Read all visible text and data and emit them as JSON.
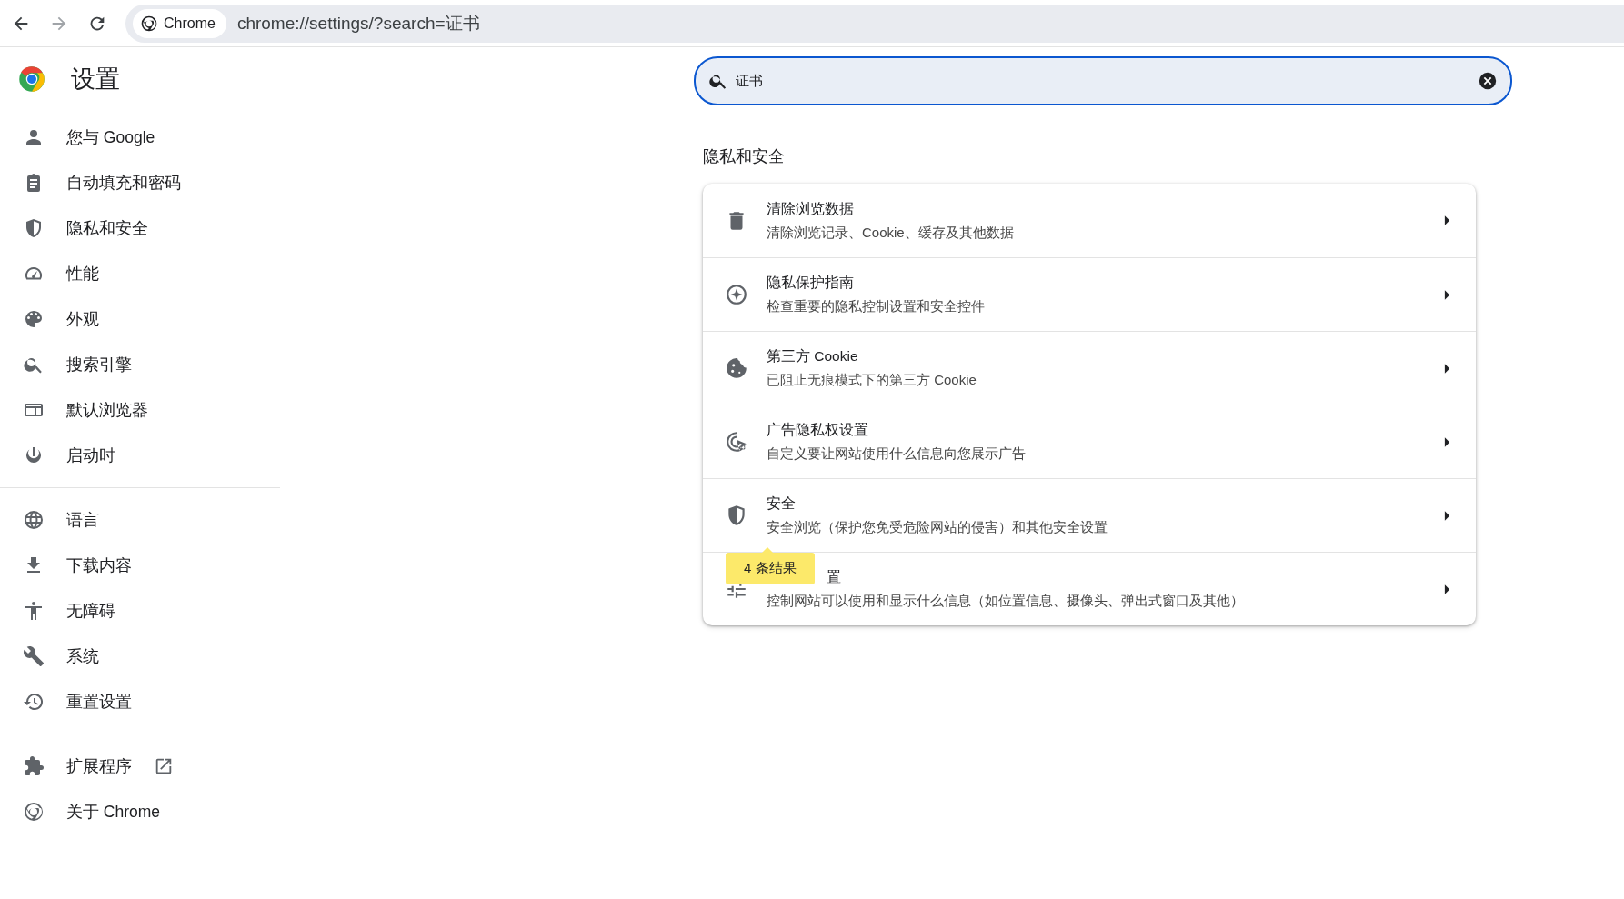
{
  "toolbar": {
    "chip": "Chrome",
    "url": "chrome://settings/?search=证书",
    "forward_disabled": true
  },
  "sidebar": {
    "title": "设置",
    "groups": [
      [
        {
          "label": "您与 Google"
        },
        {
          "label": "自动填充和密码"
        },
        {
          "label": "隐私和安全"
        },
        {
          "label": "性能"
        },
        {
          "label": "外观"
        },
        {
          "label": "搜索引擎"
        },
        {
          "label": "默认浏览器"
        },
        {
          "label": "启动时"
        }
      ],
      [
        {
          "label": "语言"
        },
        {
          "label": "下载内容"
        },
        {
          "label": "无障碍"
        },
        {
          "label": "系统"
        },
        {
          "label": "重置设置"
        }
      ],
      [
        {
          "label": "扩展程序",
          "external": true
        },
        {
          "label": "关于 Chrome",
          "external": false
        }
      ]
    ]
  },
  "search": {
    "value": "证书"
  },
  "section": {
    "title": "隐私和安全",
    "rows": [
      {
        "title": "清除浏览数据",
        "subtitle": "清除浏览记录、Cookie、缓存及其他数据"
      },
      {
        "title": "隐私保护指南",
        "subtitle": "检查重要的隐私控制设置和安全控件"
      },
      {
        "title": "第三方 Cookie",
        "subtitle": "已阻止无痕模式下的第三方 Cookie"
      },
      {
        "title": "广告隐私权设置",
        "subtitle": "自定义要让网站使用什么信息向您展示广告"
      },
      {
        "title": "安全",
        "subtitle": "安全浏览（保护您免受危险网站的侵害）和其他安全设置"
      },
      {
        "title": "置",
        "subtitle": "控制网站可以使用和显示什么信息（如位置信息、摄像头、弹出式窗口及其他）",
        "covered": true
      }
    ]
  },
  "bubble": {
    "text": "4 条结果"
  }
}
